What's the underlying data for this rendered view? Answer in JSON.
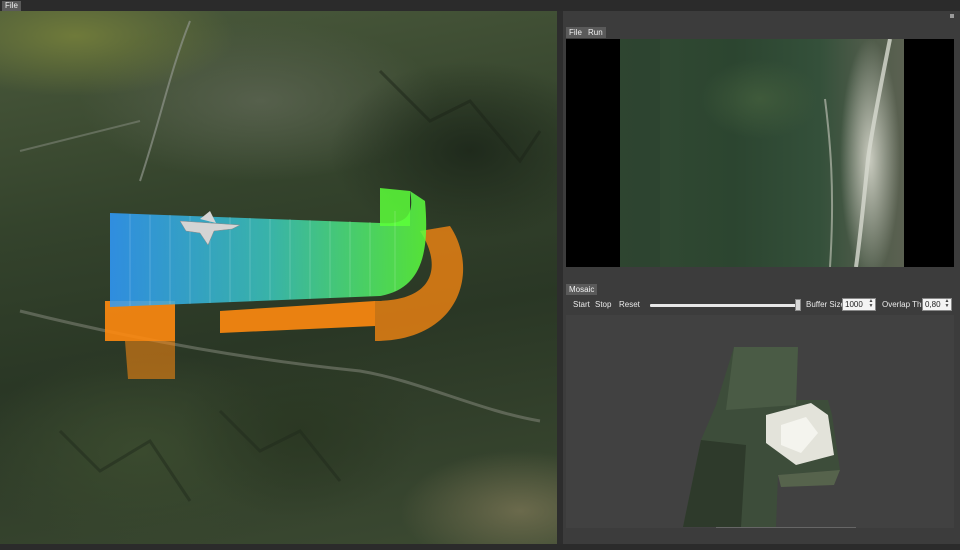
{
  "menubar": {
    "file_label": "File"
  },
  "camera_panel": {
    "menu": {
      "file_label": "File",
      "run_label": "Run"
    }
  },
  "mosaic_panel": {
    "tab_label": "Mosaic",
    "toolbar": {
      "start_label": "Start",
      "stop_label": "Stop",
      "reset_label": "Reset",
      "buffer_size_label": "Buffer Size",
      "buffer_size_value": "1000",
      "overlap_label": "Overlap Thr.",
      "overlap_value": "0,80"
    }
  },
  "colors": {
    "flight_corridor_start": "#3aa0ff",
    "flight_corridor_end": "#5cff3a",
    "ground_footprint": "#ff8a10",
    "panel_background": "#3c3c3c",
    "menu_button": "#5a5a5a"
  },
  "icons": {
    "aircraft": "aircraft-icon",
    "spin_arrows": "spin-arrows-icon"
  }
}
